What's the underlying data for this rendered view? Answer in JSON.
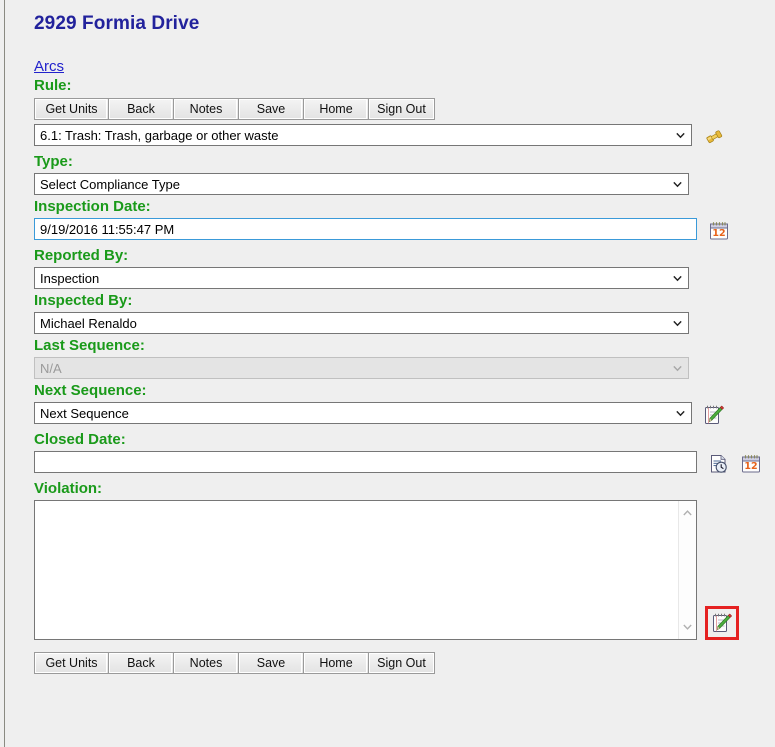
{
  "header": {
    "title": "2929 Formia Drive",
    "breadcrumb_link": "Arcs"
  },
  "toolbar": {
    "buttons": [
      {
        "label": "Get Units",
        "name": "get-units-button"
      },
      {
        "label": "Back",
        "name": "back-button"
      },
      {
        "label": "Notes",
        "name": "notes-button"
      },
      {
        "label": "Save",
        "name": "save-button"
      },
      {
        "label": "Home",
        "name": "home-button"
      },
      {
        "label": "Sign Out",
        "name": "sign-out-button"
      }
    ]
  },
  "form": {
    "rule": {
      "label": "Rule:",
      "value": "6.1: Trash: Trash, garbage or other waste",
      "icon": "gavel-icon"
    },
    "type": {
      "label": "Type:",
      "value": "Select Compliance Type"
    },
    "inspection_date": {
      "label": "Inspection Date:",
      "value": "9/19/2016 11:55:47 PM",
      "icon": "calendar-icon"
    },
    "reported_by": {
      "label": "Reported By:",
      "value": "Inspection"
    },
    "inspected_by": {
      "label": "Inspected By:",
      "value": "Michael Renaldo"
    },
    "last_sequence": {
      "label": "Last Sequence:",
      "value": "N/A",
      "disabled": true
    },
    "next_sequence": {
      "label": "Next Sequence:",
      "value": "Next Sequence",
      "icon": "notepad-pencil-icon"
    },
    "closed_date": {
      "label": "Closed Date:",
      "value": "",
      "icons": [
        "document-clock-icon",
        "calendar-icon"
      ]
    },
    "violation": {
      "label": "Violation:",
      "value": "",
      "icon": "notepad-pencil-icon"
    }
  },
  "colors": {
    "label_green": "#1a9a1a",
    "title_blue": "#22229c",
    "link_blue": "#2222cc",
    "page_background": "#efefef",
    "highlight_red": "#e52121"
  }
}
